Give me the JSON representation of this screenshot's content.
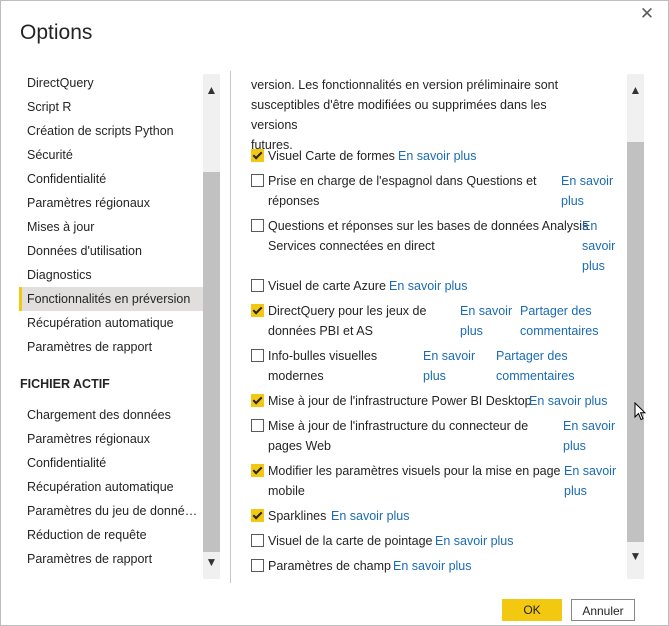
{
  "dialog": {
    "title": "Options",
    "close_glyph": "✕"
  },
  "nav": {
    "global_items": [
      "DirectQuery",
      "Script R",
      "Création de scripts Python",
      "Sécurité",
      "Confidentialité",
      "Paramètres régionaux",
      "Mises à jour",
      "Données d'utilisation",
      "Diagnostics",
      "Fonctionnalités en préversion",
      "Récupération automatique",
      "Paramètres de rapport"
    ],
    "selected": "Fonctionnalités en préversion",
    "section_header": "FICHIER ACTIF",
    "file_items": [
      "Chargement des données",
      "Paramètres régionaux",
      "Confidentialité",
      "Récupération automatique",
      "Paramètres du jeu de données actuel",
      "Réduction de requête",
      "Paramètres de rapport"
    ]
  },
  "content": {
    "intro_lines": [
      "version. Les fonctionnalités en version préliminaire sont",
      "susceptibles d'être modifiées ou supprimées dans les versions",
      "futures."
    ],
    "features": [
      {
        "label_lines": [
          "Visuel Carte de formes"
        ],
        "checked": true,
        "link1": [
          "En savoir plus"
        ],
        "link2": []
      },
      {
        "label_lines": [
          "Prise en charge de l'espagnol dans Questions et",
          "réponses"
        ],
        "checked": false,
        "link1": [
          "En savoir",
          "plus"
        ],
        "link2": []
      },
      {
        "label_lines": [
          "Questions et réponses sur les bases de données Analysis",
          "Services connectées en direct"
        ],
        "checked": false,
        "link1": [
          "En",
          "savoir",
          "plus"
        ],
        "link2": []
      },
      {
        "label_lines": [
          "Visuel de carte Azure"
        ],
        "checked": false,
        "link1": [
          "En savoir plus"
        ],
        "link2": []
      },
      {
        "label_lines": [
          "DirectQuery pour les jeux de",
          "données PBI et AS"
        ],
        "checked": true,
        "link1": [
          "En savoir",
          "plus"
        ],
        "link2": [
          "Partager des",
          "commentaires"
        ]
      },
      {
        "label_lines": [
          "Info-bulles visuelles",
          "modernes"
        ],
        "checked": false,
        "link1": [
          "En savoir",
          "plus"
        ],
        "link2": [
          "Partager des",
          "commentaires"
        ]
      },
      {
        "label_lines": [
          "Mise à jour de l'infrastructure Power BI Desktop"
        ],
        "checked": true,
        "link1": [
          "En savoir plus"
        ],
        "link2": []
      },
      {
        "label_lines": [
          "Mise à jour de l'infrastructure du connecteur de",
          "pages Web"
        ],
        "checked": false,
        "link1": [
          "En savoir",
          "plus"
        ],
        "link2": []
      },
      {
        "label_lines": [
          "Modifier les paramètres visuels pour la mise en page",
          "mobile"
        ],
        "checked": true,
        "link1": [
          "En savoir",
          "plus"
        ],
        "link2": []
      },
      {
        "label_lines": [
          "Sparklines"
        ],
        "checked": true,
        "link1": [
          "En savoir plus"
        ],
        "link2": []
      },
      {
        "label_lines": [
          "Visuel de la carte de pointage"
        ],
        "checked": false,
        "link1": [
          "En savoir plus"
        ],
        "link2": []
      },
      {
        "label_lines": [
          "Paramètres de champ"
        ],
        "checked": false,
        "link1": [
          "En savoir plus"
        ],
        "link2": []
      }
    ]
  },
  "scroll": {
    "up_glyph": "⌃",
    "down_glyph": "⌄"
  },
  "buttons": {
    "ok": "OK",
    "cancel": "Annuler"
  },
  "colors": {
    "accent": "#f2c811",
    "link": "#1a6bb5",
    "selected_bg": "#e1dfdd"
  }
}
